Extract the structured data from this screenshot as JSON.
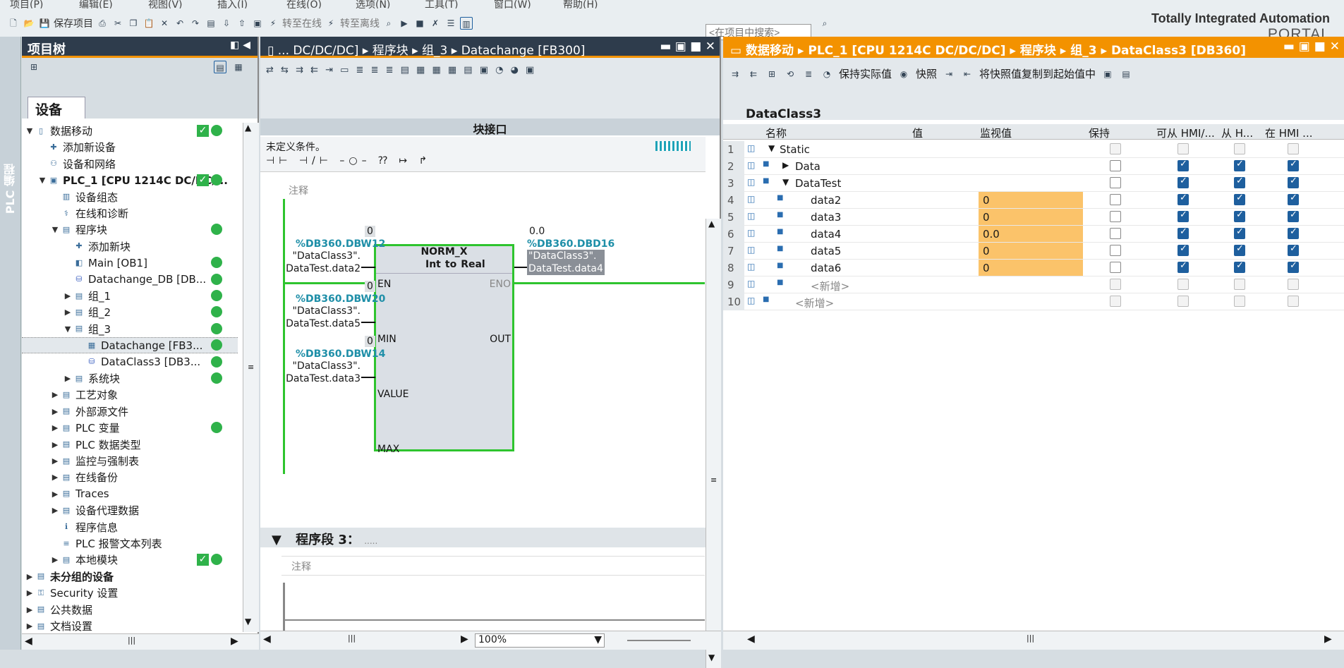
{
  "menu": [
    "项目(P)",
    "编辑(E)",
    "视图(V)",
    "插入(I)",
    "在线(O)",
    "选项(N)",
    "工具(T)",
    "窗口(W)",
    "帮助(H)"
  ],
  "toolbar": {
    "save_project": "保存项目",
    "go_online": "转至在线",
    "go_offline": "转至离线",
    "search_placeholder": "<在项目中搜索>"
  },
  "branding": {
    "line1": "Totally Integrated Automation",
    "line2": "PORTAL"
  },
  "side_strip": "PLC 编程",
  "project_tree": {
    "title": "项目树",
    "tab": "设备",
    "items": [
      {
        "label": "数据移动",
        "level": 0,
        "tog": "▼",
        "icon": "project-icon"
      },
      {
        "label": "添加新设备",
        "level": 1,
        "tog": "",
        "icon": "add-device-icon"
      },
      {
        "label": "设备和网络",
        "level": 1,
        "tog": "",
        "icon": "network-icon"
      },
      {
        "label": "PLC_1 [CPU 1214C DC/DC/...",
        "level": 1,
        "tog": "▼",
        "icon": "plc-icon",
        "bold": true
      },
      {
        "label": "设备组态",
        "level": 2,
        "tog": "",
        "icon": "device-config-icon"
      },
      {
        "label": "在线和诊断",
        "level": 2,
        "tog": "",
        "icon": "diagnostics-icon"
      },
      {
        "label": "程序块",
        "level": 2,
        "tog": "▼",
        "icon": "folder-icon"
      },
      {
        "label": "添加新块",
        "level": 3,
        "tog": "",
        "icon": "add-block-icon"
      },
      {
        "label": "Main [OB1]",
        "level": 3,
        "tog": "",
        "icon": "ob-icon"
      },
      {
        "label": "Datachange_DB [DB...",
        "level": 3,
        "tog": "",
        "icon": "db-icon"
      },
      {
        "label": "组_1",
        "level": 3,
        "tog": "▶",
        "icon": "folder-icon"
      },
      {
        "label": "组_2",
        "level": 3,
        "tog": "▶",
        "icon": "folder-icon"
      },
      {
        "label": "组_3",
        "level": 3,
        "tog": "▼",
        "icon": "folder-icon"
      },
      {
        "label": "Datachange [FB3...",
        "level": 4,
        "tog": "",
        "icon": "fb-icon",
        "selected": true
      },
      {
        "label": "DataClass3 [DB3...",
        "level": 4,
        "tog": "",
        "icon": "db-icon"
      },
      {
        "label": "系统块",
        "level": 3,
        "tog": "▶",
        "icon": "folder-icon"
      },
      {
        "label": "工艺对象",
        "level": 2,
        "tog": "▶",
        "icon": "folder-icon"
      },
      {
        "label": "外部源文件",
        "level": 2,
        "tog": "▶",
        "icon": "folder-icon"
      },
      {
        "label": "PLC 变量",
        "level": 2,
        "tog": "▶",
        "icon": "folder-icon"
      },
      {
        "label": "PLC 数据类型",
        "level": 2,
        "tog": "▶",
        "icon": "folder-icon"
      },
      {
        "label": "监控与强制表",
        "level": 2,
        "tog": "▶",
        "icon": "folder-icon"
      },
      {
        "label": "在线备份",
        "level": 2,
        "tog": "▶",
        "icon": "folder-icon"
      },
      {
        "label": "Traces",
        "level": 2,
        "tog": "▶",
        "icon": "folder-icon"
      },
      {
        "label": "设备代理数据",
        "level": 2,
        "tog": "▶",
        "icon": "folder-icon"
      },
      {
        "label": "程序信息",
        "level": 2,
        "tog": "",
        "icon": "info-icon"
      },
      {
        "label": "PLC 报警文本列表",
        "level": 2,
        "tog": "",
        "icon": "list-icon"
      },
      {
        "label": "本地模块",
        "level": 2,
        "tog": "▶",
        "icon": "folder-icon"
      },
      {
        "label": "未分组的设备",
        "level": 0,
        "tog": "▶",
        "icon": "folder-icon",
        "bold": true
      },
      {
        "label": "Security 设置",
        "level": 0,
        "tog": "▶",
        "icon": "security-icon"
      },
      {
        "label": "公共数据",
        "level": 0,
        "tog": "▶",
        "icon": "folder-icon"
      },
      {
        "label": "文档设置",
        "level": 0,
        "tog": "▶",
        "icon": "folder-icon"
      }
    ]
  },
  "editor": {
    "breadcrumb": [
      "... DC/DC/DC]",
      "程序块",
      "组_3",
      "Datachange [FB300]"
    ],
    "interface_bar": "块接口",
    "condition": "未定义条件。",
    "comment": "注释",
    "block": {
      "name": "NORM_X",
      "type_from": "Int",
      "to_word": "to",
      "type_to": "Real"
    },
    "pins": {
      "en": "EN",
      "eno": "ENO",
      "min": "MIN",
      "value": "VALUE",
      "max": "MAX",
      "out": "OUT"
    },
    "inputs": [
      {
        "monitor": "0",
        "address": "%DB360.DBW12",
        "line1": "\"DataClass3\".",
        "line2": "DataTest.data2"
      },
      {
        "monitor": "0",
        "address": "%DB360.DBW20",
        "line1": "\"DataClass3\".",
        "line2": "DataTest.data5"
      },
      {
        "monitor": "0",
        "address": "%DB360.DBW14",
        "line1": "\"DataClass3\".",
        "line2": "DataTest.data3"
      }
    ],
    "output": {
      "monitor": "0.0",
      "address": "%DB360.DBD16",
      "line1": "\"DataClass3\".",
      "line2": "DataTest.data4"
    },
    "segment3": "程序段 3：",
    "segment3_dots": ".....",
    "comment2": "注释",
    "zoom": "100%"
  },
  "db": {
    "breadcrumb": [
      "数据移动",
      "PLC_1 [CPU 1214C DC/DC/DC]",
      "程序块",
      "组_3",
      "DataClass3 [DB360]"
    ],
    "toolbar": {
      "keep_actual": "保持实际值",
      "snapshot": "快照",
      "copy_snapshot": "将快照值复制到起始值中"
    },
    "name": "DataClass3",
    "headers": {
      "name": "名称",
      "start": "值",
      "monitor": "监视值",
      "retain": "保持",
      "hmi1": "可从 HMI/...",
      "hmi2": "从 H...",
      "hmi3": "在 HMI ..."
    },
    "rows": [
      {
        "num": "1",
        "name": "Static",
        "tog": "▼",
        "indent": 0,
        "monitor": "",
        "retain": "dis",
        "hmi": [
          "dis",
          "dis",
          "dis"
        ]
      },
      {
        "num": "2",
        "name": "Data",
        "tog": "▶",
        "indent": 1,
        "monitor": "",
        "retain": "off",
        "hmi": [
          "on",
          "on",
          "on"
        ]
      },
      {
        "num": "3",
        "name": "DataTest",
        "tog": "▼",
        "indent": 1,
        "monitor": "",
        "retain": "off",
        "hmi": [
          "on",
          "on",
          "on"
        ]
      },
      {
        "num": "4",
        "name": "data2",
        "tog": "",
        "indent": 2,
        "monitor": "0",
        "retain": "off",
        "hmi": [
          "on",
          "on",
          "on"
        ]
      },
      {
        "num": "5",
        "name": "data3",
        "tog": "",
        "indent": 2,
        "monitor": "0",
        "retain": "off",
        "hmi": [
          "on",
          "on",
          "on"
        ]
      },
      {
        "num": "6",
        "name": "data4",
        "tog": "",
        "indent": 2,
        "monitor": "0.0",
        "retain": "off",
        "hmi": [
          "on",
          "on",
          "on"
        ]
      },
      {
        "num": "7",
        "name": "data5",
        "tog": "",
        "indent": 2,
        "monitor": "0",
        "retain": "off",
        "hmi": [
          "on",
          "on",
          "on"
        ]
      },
      {
        "num": "8",
        "name": "data6",
        "tog": "",
        "indent": 2,
        "monitor": "0",
        "retain": "off",
        "hmi": [
          "on",
          "on",
          "on"
        ]
      },
      {
        "num": "9",
        "name": "<新增>",
        "tog": "",
        "indent": 2,
        "monitor": "",
        "retain": "dis",
        "hmi": [
          "dis",
          "dis",
          "dis"
        ],
        "grey": true
      },
      {
        "num": "10",
        "name": "<新增>",
        "tog": "",
        "indent": 1,
        "monitor": "",
        "retain": "dis",
        "hmi": [
          "dis",
          "dis",
          "dis"
        ],
        "grey": true
      }
    ]
  }
}
